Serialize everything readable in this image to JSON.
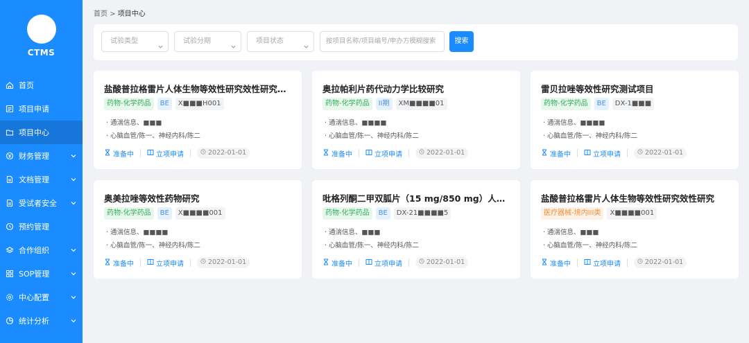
{
  "app": {
    "name": "CTMS"
  },
  "sidebar": {
    "items": [
      {
        "label": "首页",
        "icon": "home-icon",
        "has_children": false,
        "active": false
      },
      {
        "label": "项目申请",
        "icon": "form-icon",
        "has_children": false,
        "active": false
      },
      {
        "label": "项目中心",
        "icon": "folder-icon",
        "has_children": false,
        "active": true
      },
      {
        "label": "财务管理",
        "icon": "currency-icon",
        "has_children": true,
        "active": false
      },
      {
        "label": "文档管理",
        "icon": "document-icon",
        "has_children": true,
        "active": false
      },
      {
        "label": "受试者安全",
        "icon": "document-icon",
        "has_children": true,
        "active": false
      },
      {
        "label": "预约管理",
        "icon": "clock-icon",
        "has_children": false,
        "active": false
      },
      {
        "label": "合作组织",
        "icon": "layers-icon",
        "has_children": true,
        "active": false
      },
      {
        "label": "SOP管理",
        "icon": "grid-icon",
        "has_children": true,
        "active": false
      },
      {
        "label": "中心配置",
        "icon": "gear-icon",
        "has_children": true,
        "active": false
      },
      {
        "label": "统计分析",
        "icon": "pie-chart-icon",
        "has_children": true,
        "active": false
      }
    ]
  },
  "breadcrumb": {
    "home": "首页",
    "separator": ">",
    "current": "项目中心"
  },
  "filters": {
    "trial_type_placeholder": "试验类型",
    "trial_phase_placeholder": "试验分期",
    "project_status_placeholder": "项目状态",
    "search_placeholder": "按项目名称/项目编号/申办方模糊搜索",
    "search_button": "搜索"
  },
  "cards": [
    {
      "title": "盐酸普拉格雷片人体生物等效性研究效性研究（预...",
      "category": "药物-化学药品",
      "category_color": "green",
      "phase": "BE",
      "code": "X■■■H001",
      "line1": "· 通湍信息、■■■",
      "line2": "· 心脑血管/陈一、神经内科/陈二",
      "status": "准备中",
      "apply": "立项申请",
      "date": "2022-01-01"
    },
    {
      "title": "奥拉帕利片药代动力学比较研究",
      "category": "药物-化学药品",
      "category_color": "green",
      "phase": "II期",
      "code": "XM■■■■01",
      "line1": "· 通湍信息、■■■■",
      "line2": "· 心脑血管/陈一、神经内科/陈二",
      "status": "准备中",
      "apply": "立项申请",
      "date": "2022-01-01"
    },
    {
      "title": "雷贝拉唑等效性研究测试项目",
      "category": "药物-化学药品",
      "category_color": "green",
      "phase": "BE",
      "code": "DX-1■■■",
      "line1": "· 通湍信息、■■■■",
      "line2": "· 心脑血管/陈一、神经内科/陈二",
      "status": "准备中",
      "apply": "立项申请",
      "date": "2022-01-01"
    },
    {
      "title": "奥美拉唑等效性药物研究",
      "category": "药物-化学药品",
      "category_color": "green",
      "phase": "BE",
      "code": "X■■■■001",
      "line1": "· 通湍信息、■■■■",
      "line2": "· 心脑血管/陈一、神经内科/陈二",
      "status": "准备中",
      "apply": "立项申请",
      "date": "2022-01-01"
    },
    {
      "title": "吡格列酮二甲双胍片（15 mg/850 mg）人体生物...",
      "category": "药物-化学药品",
      "category_color": "green",
      "phase": "BE",
      "code": "DX-21■■■■5",
      "line1": "· 通湍信息、■■■",
      "line2": "· 心脑血管/陈一、神经内科/陈二",
      "status": "准备中",
      "apply": "立项申请",
      "date": "2022-01-01"
    },
    {
      "title": "盐酸普拉格雷片人体生物等效性研究效性研究",
      "category": "医疗器械-境内III类",
      "category_color": "orange",
      "phase": "",
      "code": "X■■■■001",
      "line1": "· 通湍信息、■■■",
      "line2": "· 心脑血管/陈一、神经内科/陈二",
      "status": "准备中",
      "apply": "立项申请",
      "date": "2022-01-01"
    }
  ]
}
